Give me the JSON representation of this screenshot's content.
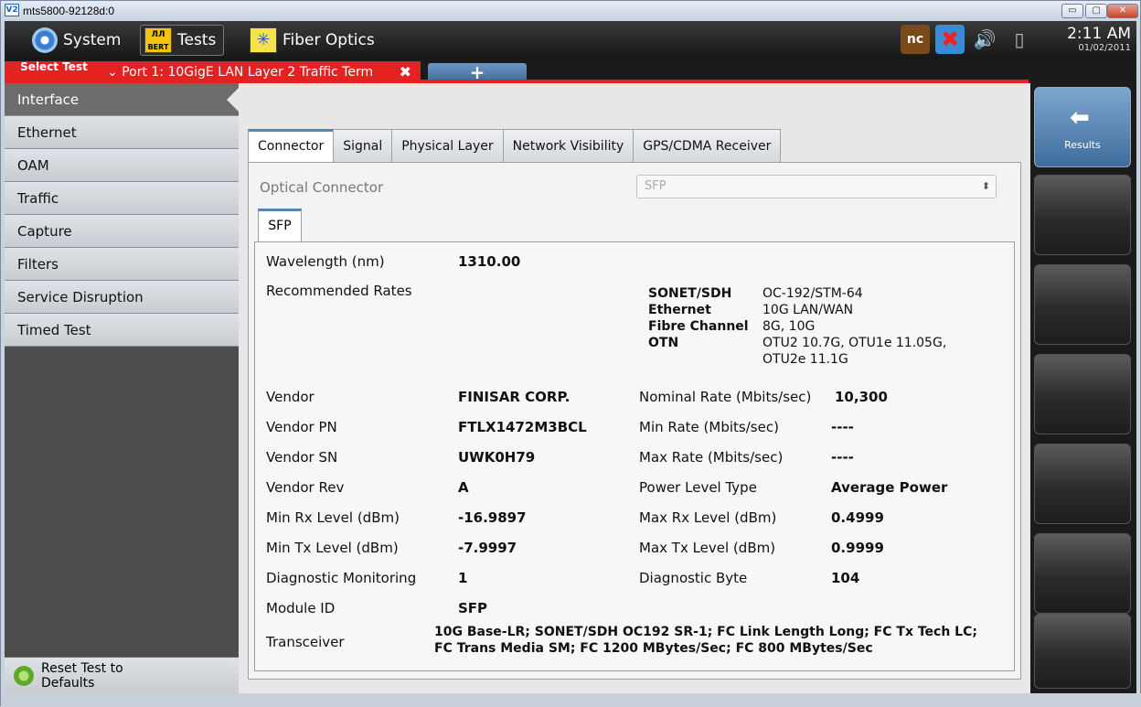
{
  "window": {
    "title": "mts5800-92128d:0",
    "vnc_icon": "V2"
  },
  "topbar": {
    "system_label": "System",
    "tests_label": "Tests",
    "bert_icon_text": "BERT",
    "fiber_label": "Fiber Optics",
    "clock_time": "2:11 AM",
    "clock_date": "01/02/2011",
    "nc_icon_text": "nc"
  },
  "tabstrip": {
    "select_test": "Select Test",
    "port_tab": "Port 1: 10GigE LAN Layer 2 Traffic Term",
    "close_glyph": "✖",
    "add_glyph": "+"
  },
  "sidebar": {
    "items": [
      {
        "label": "Interface"
      },
      {
        "label": "Ethernet"
      },
      {
        "label": "OAM"
      },
      {
        "label": "Traffic"
      },
      {
        "label": "Capture"
      },
      {
        "label": "Filters"
      },
      {
        "label": "Service Disruption"
      },
      {
        "label": "Timed Test"
      }
    ],
    "reset_label": "Reset Test to Defaults"
  },
  "main": {
    "tabs": [
      {
        "label": "Connector"
      },
      {
        "label": "Signal"
      },
      {
        "label": "Physical Layer"
      },
      {
        "label": "Network Visibility"
      },
      {
        "label": "GPS/CDMA Receiver"
      }
    ],
    "optical_connector_label": "Optical Connector",
    "optical_connector_value": "SFP",
    "subtab": "SFP",
    "sfp": {
      "wavelength_label": "Wavelength (nm)",
      "wavelength_value": "1310.00",
      "recommended_rates_label": "Recommended Rates",
      "rates": [
        {
          "name": "SONET/SDH",
          "value": "OC-192/STM-64"
        },
        {
          "name": "Ethernet",
          "value": "10G LAN/WAN"
        },
        {
          "name": "Fibre Channel",
          "value": "8G, 10G"
        },
        {
          "name": "OTN",
          "value": "OTU2 10.7G, OTU1e 11.05G,",
          "value2": "OTU2e 11.1G"
        }
      ],
      "left_rows": [
        {
          "label": "Vendor",
          "value": "FINISAR CORP."
        },
        {
          "label": "Vendor PN",
          "value": "FTLX1472M3BCL"
        },
        {
          "label": "Vendor SN",
          "value": "UWK0H79"
        },
        {
          "label": "Vendor Rev",
          "value": "A"
        },
        {
          "label": "Min Rx Level (dBm)",
          "value": "-16.9897"
        },
        {
          "label": "Min Tx Level (dBm)",
          "value": "-7.9997"
        },
        {
          "label": "Diagnostic Monitoring",
          "value": "1"
        },
        {
          "label": "Module ID",
          "value": "SFP"
        }
      ],
      "right_rows": [
        {
          "label": "Nominal Rate (Mbits/sec)",
          "value": "10,300"
        },
        {
          "label": "Min Rate (Mbits/sec)",
          "value": "----"
        },
        {
          "label": "Max Rate (Mbits/sec)",
          "value": "----"
        },
        {
          "label": "Power Level Type",
          "value": "Average Power"
        },
        {
          "label": "Max Rx Level (dBm)",
          "value": "0.4999"
        },
        {
          "label": "Max Tx Level (dBm)",
          "value": "0.9999"
        },
        {
          "label": "Diagnostic Byte",
          "value": "104"
        }
      ],
      "transceiver_label": "Transceiver",
      "transceiver_line1": "10G Base-LR; SONET/SDH OC192 SR-1; FC Link Length Long; FC Tx Tech LC;",
      "transceiver_line2": "FC Trans Media SM; FC 1200 MBytes/Sec; FC 800 MBytes/Sec"
    }
  },
  "right": {
    "results_label": "Results",
    "results_icon": "⬅"
  },
  "colors": {
    "accent_red": "#e52222",
    "tab_blue": "#5a84b6"
  }
}
